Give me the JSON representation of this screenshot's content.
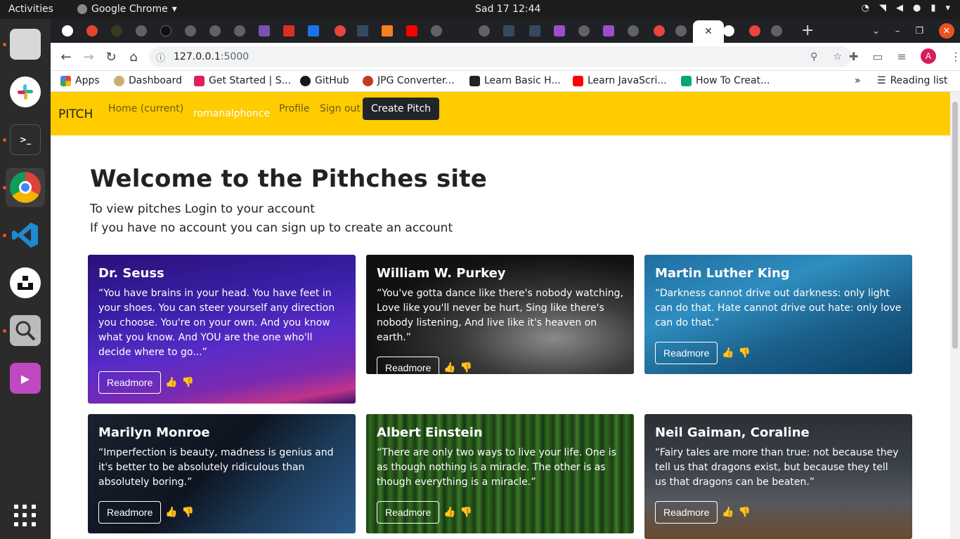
{
  "system": {
    "activities": "Activities",
    "app_name": "Google Chrome",
    "app_menu_arrow": "▾",
    "clock": "Sad 17  12:44"
  },
  "browser": {
    "url_host": "127.0.0.1",
    "url_port": ":5000",
    "avatar_letter": "A",
    "reading_list": "Reading list",
    "bookmarks_overflow": "»",
    "bookmarks": [
      {
        "label": "Apps",
        "color": "#4285f4"
      },
      {
        "label": "Dashboard",
        "color": "#8a6a20"
      },
      {
        "label": "Get Started | S...",
        "color": "#e01e5a"
      },
      {
        "label": "GitHub",
        "color": "#181717"
      },
      {
        "label": "JPG Converter...",
        "color": "#c0392b"
      },
      {
        "label": "Learn Basic H...",
        "color": "#222222"
      },
      {
        "label": "Learn JavaScri...",
        "color": "#ff0000"
      },
      {
        "label": "How To Creat...",
        "color": "#04aa6d"
      }
    ]
  },
  "site": {
    "brand": "PITCH",
    "nav": {
      "home": "Home (current)",
      "username": "romanalphonce",
      "profile": "Profile",
      "signout": "Sign out",
      "create": "Create Pitch"
    },
    "hero": {
      "title": "Welcome to the Pithches site",
      "line1": "To view pitches Login to your account",
      "line2": "If you have no account you can sign up to create an account"
    },
    "readmore_label": "Readmore",
    "like_icon": "👍",
    "dislike_icon": "👎",
    "cards": [
      {
        "author": "Dr. Seuss",
        "quote": "“You have brains in your head. You have feet in your shoes. You can steer yourself any direction you choose. You're on your own. And you know what you know. And YOU are the one who'll decide where to go...”"
      },
      {
        "author": "William W. Purkey",
        "quote": "“You've gotta dance like there's nobody watching, Love like you'll never be hurt, Sing like there's nobody listening, And live like it's heaven on earth.”"
      },
      {
        "author": "Martin Luther King",
        "quote": "“Darkness cannot drive out darkness: only light can do that. Hate cannot drive out hate: only love can do that.”"
      },
      {
        "author": "Marilyn Monroe",
        "quote": "“Imperfection is beauty, madness is genius and it's better to be absolutely ridiculous than absolutely boring.”"
      },
      {
        "author": "Albert Einstein",
        "quote": "“There are only two ways to live your life. One is as though nothing is a miracle. The other is as though everything is a miracle.”"
      },
      {
        "author": "Neil Gaiman, Coraline",
        "quote": "“Fairy tales are more than true: not because they tell us that dragons exist, but because they tell us that dragons can be beaten.”"
      }
    ]
  }
}
